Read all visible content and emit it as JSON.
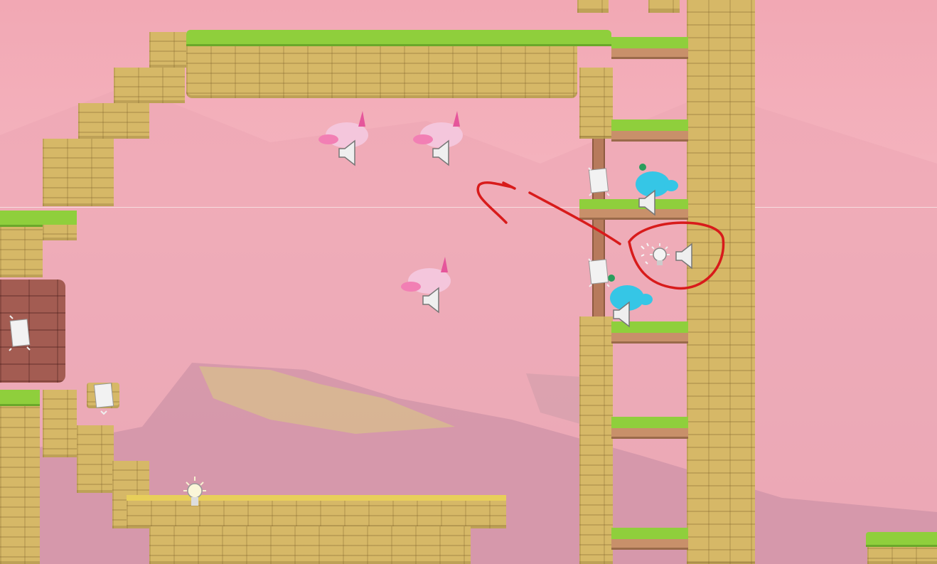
{
  "scene": {
    "type": "2D platformer level editor viewport",
    "colors": {
      "sky": "#f2a8b4",
      "stone": "#d6b867",
      "grass": "#8fcf3c",
      "annotation": "#d81b1b",
      "pink_creature": "#f4c6dc",
      "blue_creature": "#35c6e6"
    }
  },
  "entities": [
    {
      "kind": "pink-creature",
      "icon": "speaker-icon"
    },
    {
      "kind": "pink-creature",
      "icon": "speaker-icon"
    },
    {
      "kind": "pink-creature",
      "icon": "speaker-icon"
    },
    {
      "kind": "blue-creature",
      "icon": "speaker-icon"
    },
    {
      "kind": "blue-creature",
      "icon": "speaker-icon"
    }
  ],
  "gizmos": [
    "particle-emitter-icon",
    "light-bulb-icon",
    "speaker-icon"
  ],
  "annotation": {
    "shape": "circle-with-arrow",
    "color": "#d81b1b"
  }
}
